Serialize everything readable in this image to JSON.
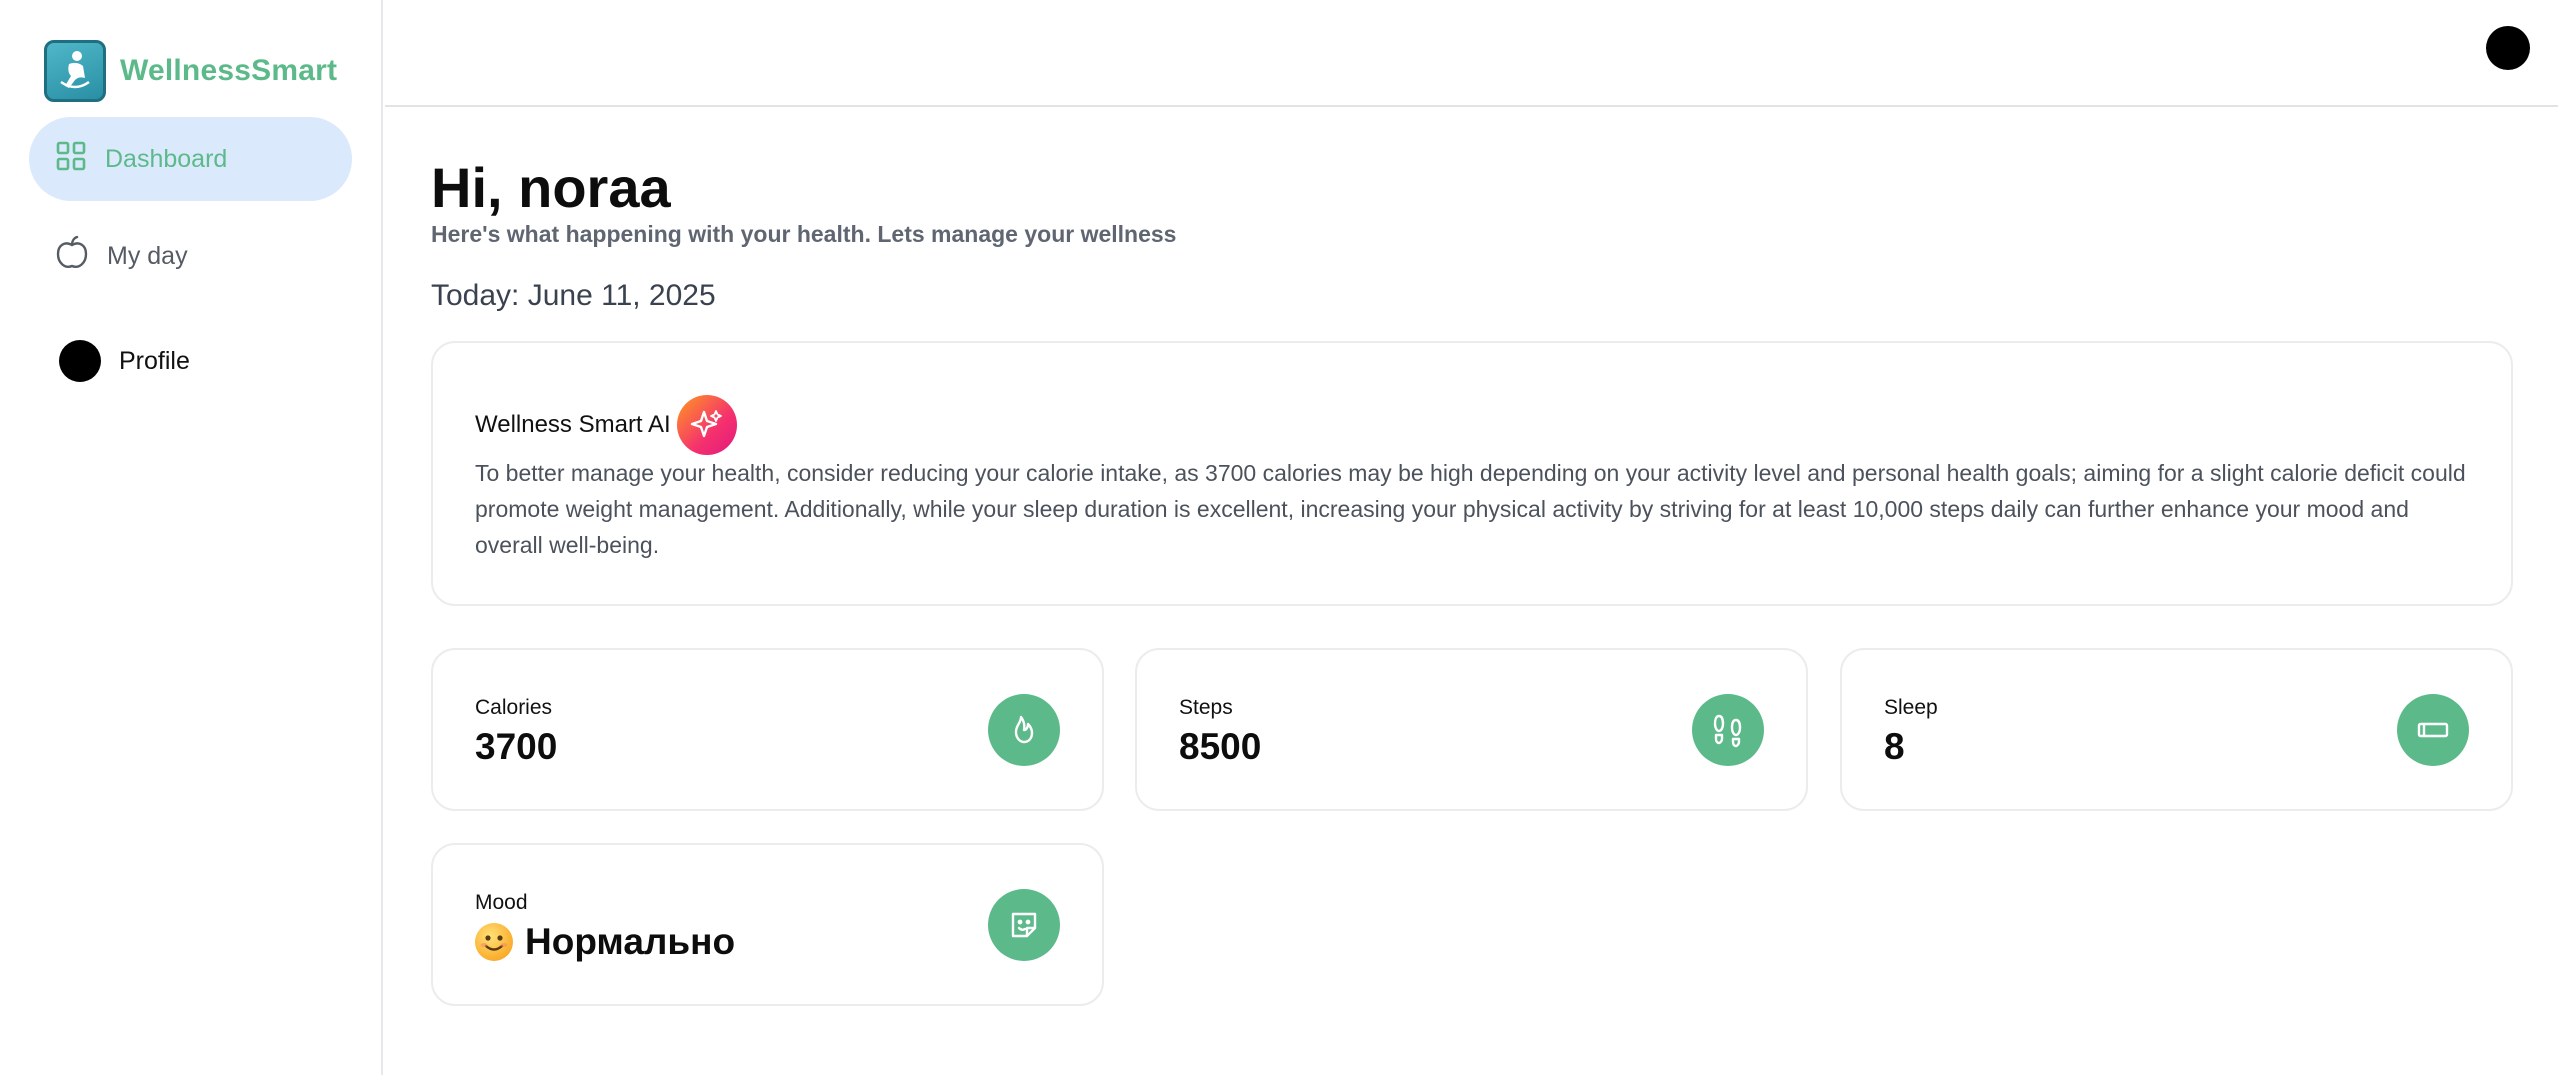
{
  "brand": {
    "name": "WellnessSmart"
  },
  "sidebar": {
    "items": [
      {
        "label": "Dashboard",
        "icon": "grid-icon",
        "active": true
      },
      {
        "label": "My day",
        "icon": "apple-icon",
        "active": false
      },
      {
        "label": "Profile",
        "icon": "avatar",
        "active": false
      }
    ]
  },
  "header": {
    "greeting": "Hi, noraa",
    "subtitle": "Here's what happening with your health. Lets manage your wellness",
    "today": "Today: June 11, 2025"
  },
  "ai": {
    "title": "Wellness Smart AI",
    "icon": "sparkle-icon",
    "text": "To better manage your health, consider reducing your calorie intake, as 3700 calories may be high depending on your activity level and personal health goals; aiming for a slight calorie deficit could promote weight management. Additionally, while your sleep duration is excellent, increasing your physical activity by striving for at least 10,000 steps daily can further enhance your mood and overall well-being."
  },
  "stats": {
    "calories": {
      "label": "Calories",
      "value": "3700",
      "icon": "flame-icon"
    },
    "steps": {
      "label": "Steps",
      "value": "8500",
      "icon": "footprints-icon"
    },
    "sleep": {
      "label": "Sleep",
      "value": "8",
      "icon": "bed-icon"
    },
    "mood": {
      "label": "Mood",
      "value": "Нормально",
      "emoji": "smiling-face",
      "icon": "sticker-icon"
    }
  },
  "colors": {
    "accent": "#5cba8a",
    "active_nav_bg": "#dbe9fc",
    "ai_gradient_start": "#ff9a1f",
    "ai_gradient_end": "#e0197d"
  }
}
